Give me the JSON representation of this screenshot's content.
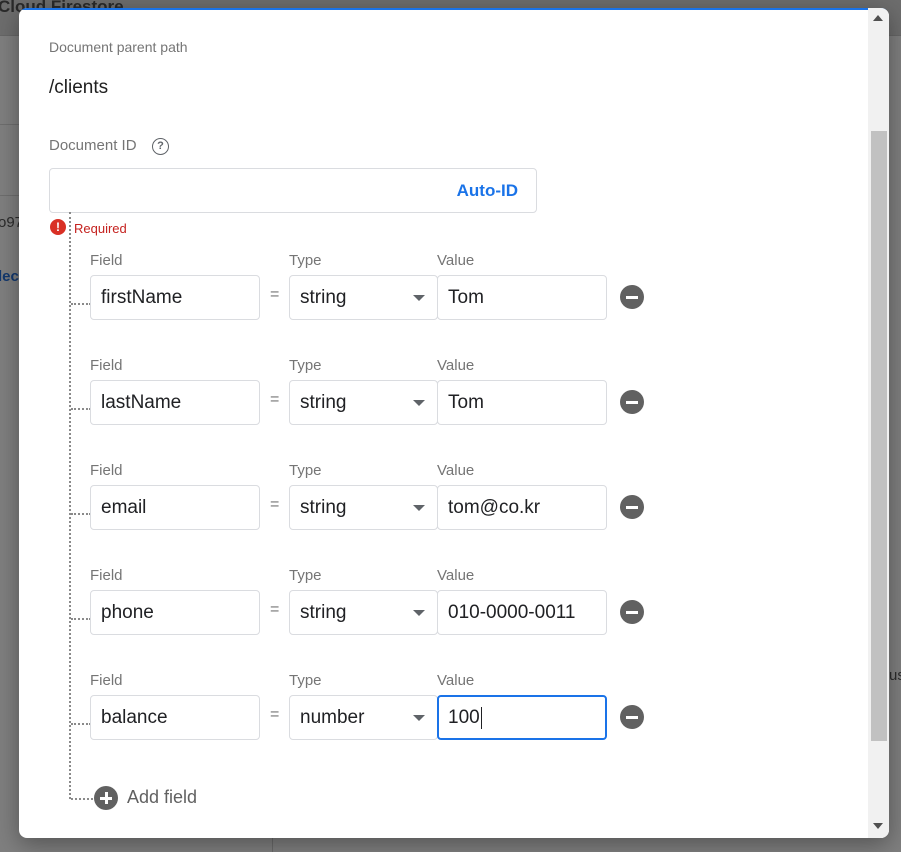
{
  "background": {
    "app_title": "Cloud Firestore",
    "snippet_left_1": "o97",
    "snippet_left_2": "lec",
    "snippet_right": "us"
  },
  "dialog": {
    "parent_path_label": "Document parent path",
    "parent_path_value": "/clients",
    "document_id_label": "Document ID",
    "help_icon_glyph": "?",
    "document_id_value": "",
    "auto_id_label": "Auto-ID",
    "error_glyph": "!",
    "error_text": "Required",
    "column_labels": {
      "field": "Field",
      "type": "Type",
      "value": "Value"
    },
    "equals_sign": "=",
    "fields": [
      {
        "field": "firstName",
        "type": "string",
        "value": "Tom"
      },
      {
        "field": "lastName",
        "type": "string",
        "value": "Tom"
      },
      {
        "field": "email",
        "type": "string",
        "value": "tom@co.kr"
      },
      {
        "field": "phone",
        "type": "string",
        "value": "010-0000-0011"
      },
      {
        "field": "balance",
        "type": "number",
        "value": "100",
        "focused": true
      }
    ],
    "add_field_label": "Add field"
  },
  "colors": {
    "accent": "#1a73e8",
    "error": "#d93025",
    "icon_gray": "#616161"
  },
  "icons": {
    "help": "help-circle-icon",
    "error": "error-circle-icon",
    "remove": "remove-circle-icon",
    "add": "add-circle-icon",
    "dropdown": "chevron-down-icon"
  }
}
